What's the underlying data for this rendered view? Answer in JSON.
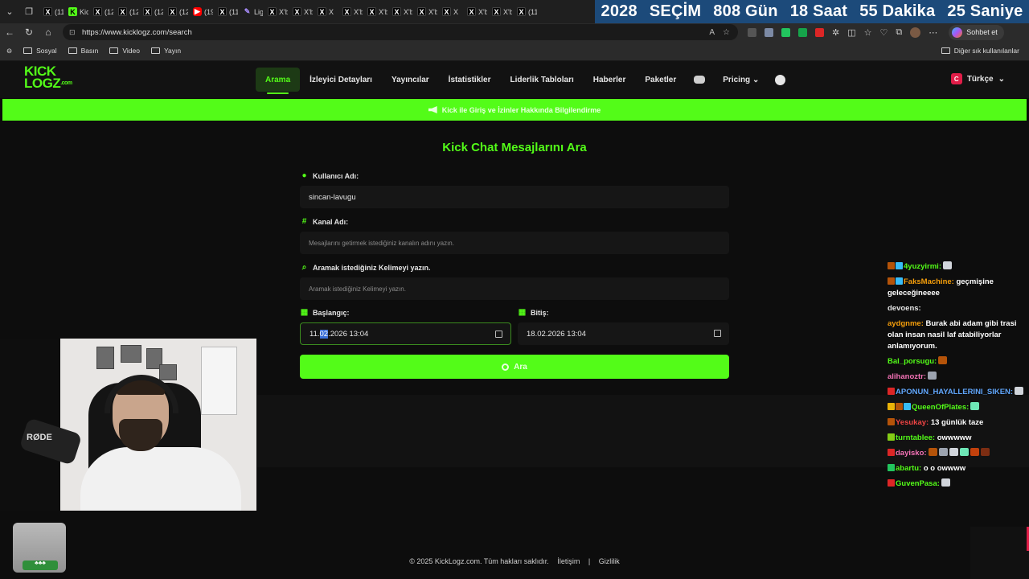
{
  "browser": {
    "tabs": [
      {
        "icon": "x-icon",
        "label": "(11"
      },
      {
        "icon": "kick-icon",
        "label": "Kic"
      },
      {
        "icon": "x-icon",
        "label": "(12"
      },
      {
        "icon": "x-icon",
        "label": "(12"
      },
      {
        "icon": "x-icon",
        "label": "(12"
      },
      {
        "icon": "x-icon",
        "label": "(12"
      },
      {
        "icon": "youtube-icon",
        "label": "(19"
      },
      {
        "icon": "x-icon",
        "label": "(11"
      },
      {
        "icon": "pen-icon",
        "label": "Lig"
      },
      {
        "icon": "x-icon",
        "label": "X'b"
      },
      {
        "icon": "x-icon",
        "label": "X'b"
      },
      {
        "icon": "x-icon",
        "label": "X"
      },
      {
        "icon": "x-icon",
        "label": "X'b"
      },
      {
        "icon": "x-icon",
        "label": "X'b"
      },
      {
        "icon": "x-icon",
        "label": "X'b"
      },
      {
        "icon": "x-icon",
        "label": "X'b"
      },
      {
        "icon": "x-icon",
        "label": "X"
      },
      {
        "icon": "x-icon",
        "label": "X'b"
      },
      {
        "icon": "x-icon",
        "label": "X'b"
      },
      {
        "icon": "x-icon",
        "label": "(11"
      }
    ],
    "url": "https://www.kicklogz.com/search",
    "chat_button": "Sohbet et",
    "bookmarks": [
      "Sosyal",
      "Basın",
      "Video",
      "Yayın"
    ],
    "other_bookmarks": "Diğer sık kullanılanlar"
  },
  "countdown": {
    "year": "2028",
    "label": "SEÇİM",
    "days": "808 Gün",
    "hours": "18 Saat",
    "minutes": "55 Dakika",
    "seconds": "25 Saniye"
  },
  "site": {
    "logo_line1": "KICK",
    "logo_line2": "LOGZ",
    "logo_suffix": ".com",
    "nav": {
      "search": "Arama",
      "viewer": "İzleyici Detayları",
      "streamers": "Yayıncılar",
      "stats": "İstatistikler",
      "leaderboards": "Liderlik Tabloları",
      "news": "Haberler",
      "packages": "Paketler",
      "pricing": "Pricing"
    },
    "language": "Türkçe",
    "language_flag": "C",
    "announcement": "Kick ile Giriş ve İzinler Hakkında Bilgilendirme"
  },
  "form": {
    "title": "Kick Chat Mesajlarını Ara",
    "username_label": "Kullanıcı Adı:",
    "username_value": "sincan-lavugu",
    "channel_label": "Kanal Adı:",
    "channel_placeholder": "Mesajlarını getirmek istediğiniz kanalın adını yazın.",
    "keyword_label": "Aramak istediğiniz Kelimeyi yazın.",
    "keyword_placeholder": "Aramak istediğiniz Kelimeyi yazın.",
    "start_label": "Başlangıç:",
    "start_day": "11.",
    "start_month_selected": "02",
    "start_rest": ".2026  13:04",
    "end_label": "Bitiş:",
    "end_value": "18.02.2026  13:04",
    "search_button": "Ara"
  },
  "webcam": {
    "mic_brand": "RØDE"
  },
  "chat": [
    {
      "user": "4yuzyirmi:",
      "color": "#53fc18",
      "text": "",
      "badges": [
        "#b45309",
        "#38bdf8"
      ],
      "emote": true
    },
    {
      "user": "FaksMachine:",
      "color": "#f59e0b",
      "text": " geçmişine geleceğineeee",
      "badges": [
        "#b45309",
        "#38bdf8"
      ],
      "emote": false
    },
    {
      "user": "devoens:",
      "color": "#e5e5e5",
      "text": "",
      "badges": [],
      "emote": false
    },
    {
      "user": "aydgnme:",
      "color": "#f59e0b",
      "text": " Burak abi adam gibi trasi olan insan nasil laf atabiliyorlar anlamıyorum.",
      "badges": [],
      "emote": false
    },
    {
      "user": "Bal_porsugu:",
      "color": "#53fc18",
      "text": "",
      "badges": [],
      "emote": true
    },
    {
      "user": "alihanoztr:",
      "color": "#f472b6",
      "text": "",
      "badges": [],
      "emote": true
    },
    {
      "user": "APONUN_HAYALLERINI_SIKEN:",
      "color": "#60a5fa",
      "text": "",
      "badges": [
        "#dc2626"
      ],
      "emote": true
    },
    {
      "user": "QueenOfPlates:",
      "color": "#53fc18",
      "text": "",
      "badges": [
        "#eab308",
        "#b45309",
        "#38bdf8"
      ],
      "emote": true
    },
    {
      "user": "Yesukay:",
      "color": "#ef4444",
      "text": " 13 günlük taze",
      "badges": [
        "#b45309"
      ],
      "emote": false
    },
    {
      "user": "turntablee:",
      "color": "#53fc18",
      "text": " owwwww",
      "badges": [
        "#84cc16"
      ],
      "emote": false
    },
    {
      "user": "dayisko:",
      "color": "#f472b6",
      "text": "",
      "badges": [
        "#dc2626"
      ],
      "emote": true
    },
    {
      "user": "abartu:",
      "color": "#53fc18",
      "text": " o o owwww",
      "badges": [
        "#22c55e"
      ],
      "emote": false
    },
    {
      "user": "GuvenPasa:",
      "color": "#53fc18",
      "text": "",
      "badges": [
        "#dc2626"
      ],
      "emote": true
    }
  ],
  "footer": {
    "copyright": "© 2025 KickLogz.com. Tüm hakları saklıdır.",
    "contact": "İletişim",
    "separator": "|",
    "privacy": "Gizlilik"
  }
}
